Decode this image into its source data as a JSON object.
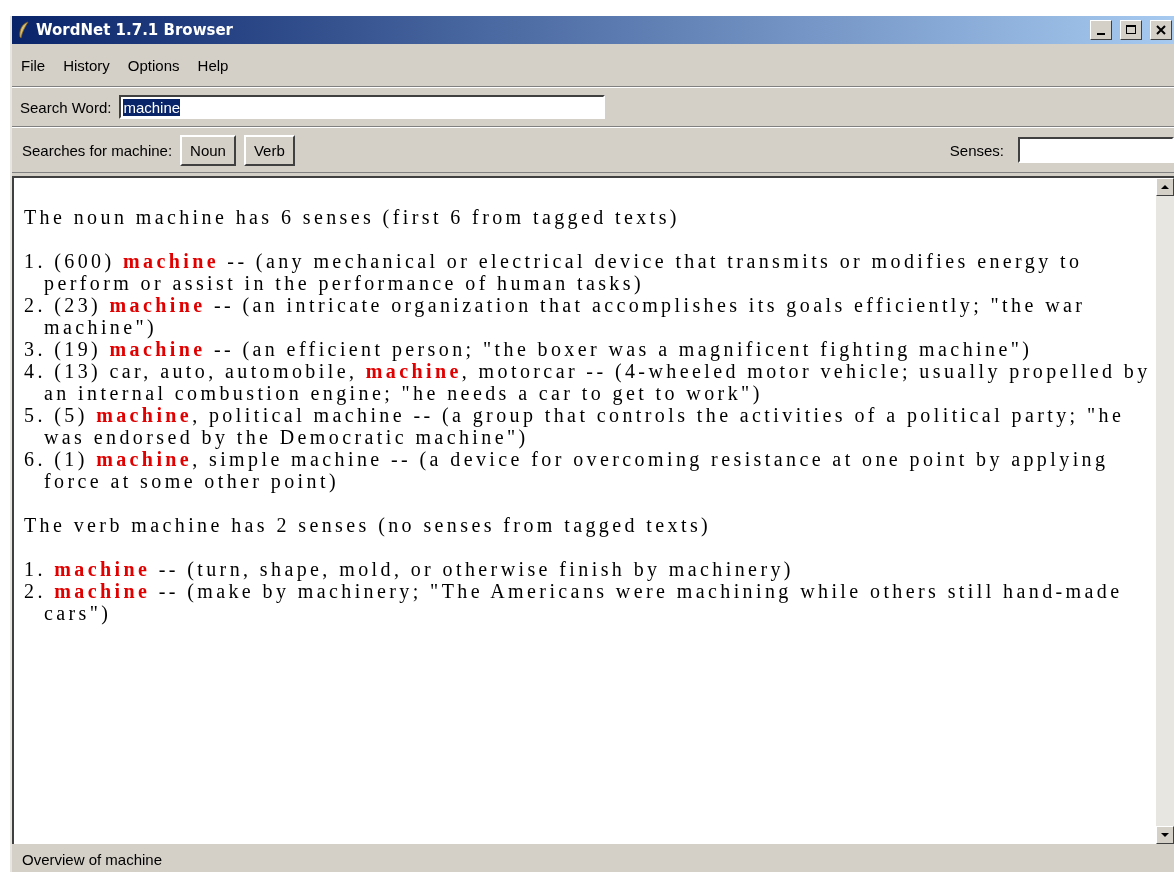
{
  "window": {
    "title": "WordNet 1.7.1 Browser"
  },
  "menu": [
    "File",
    "History",
    "Options",
    "Help"
  ],
  "search": {
    "label": "Search Word:",
    "value": "machine",
    "value_selected": true
  },
  "searches": {
    "label": "Searches for machine:",
    "buttons": [
      "Noun",
      "Verb"
    ],
    "senses_label": "Senses:"
  },
  "content": [
    {
      "kind": "heading",
      "text": "The noun machine has 6 senses (first 6 from tagged texts)"
    },
    {
      "kind": "sense",
      "text": "1. (600) **machine** -- (any mechanical or electrical device that transmits or modifies energy to perform or assist in the performance of human tasks)"
    },
    {
      "kind": "sense",
      "text": "2. (23) **machine** -- (an intricate organization that accomplishes its goals efficiently; \"the war machine\")"
    },
    {
      "kind": "sense",
      "text": "3. (19) **machine** -- (an efficient person; \"the boxer was a magnificent fighting machine\")"
    },
    {
      "kind": "sense",
      "text": "4. (13) car, auto, automobile, **machine**, motorcar -- (4-wheeled motor vehicle; usually propelled by an internal combustion engine; \"he needs a car to get to work\")"
    },
    {
      "kind": "sense",
      "text": "5. (5) **machine**, political machine -- (a group that controls the activities of a political party; \"he was endorsed by the Democratic machine\")"
    },
    {
      "kind": "sense",
      "text": "6. (1) **machine**, simple machine -- (a device for overcoming resistance at one point by applying force at some other point)"
    },
    {
      "kind": "heading",
      "text": "The verb machine has 2 senses (no senses from tagged texts)"
    },
    {
      "kind": "sense",
      "text": "1. **machine** -- (turn, shape, mold, or otherwise finish by machinery)"
    },
    {
      "kind": "sense",
      "text": "2. **machine** -- (make by machinery; \"The Americans were machining while others still hand-made cars\")"
    }
  ],
  "status_bar": "Overview of machine"
}
